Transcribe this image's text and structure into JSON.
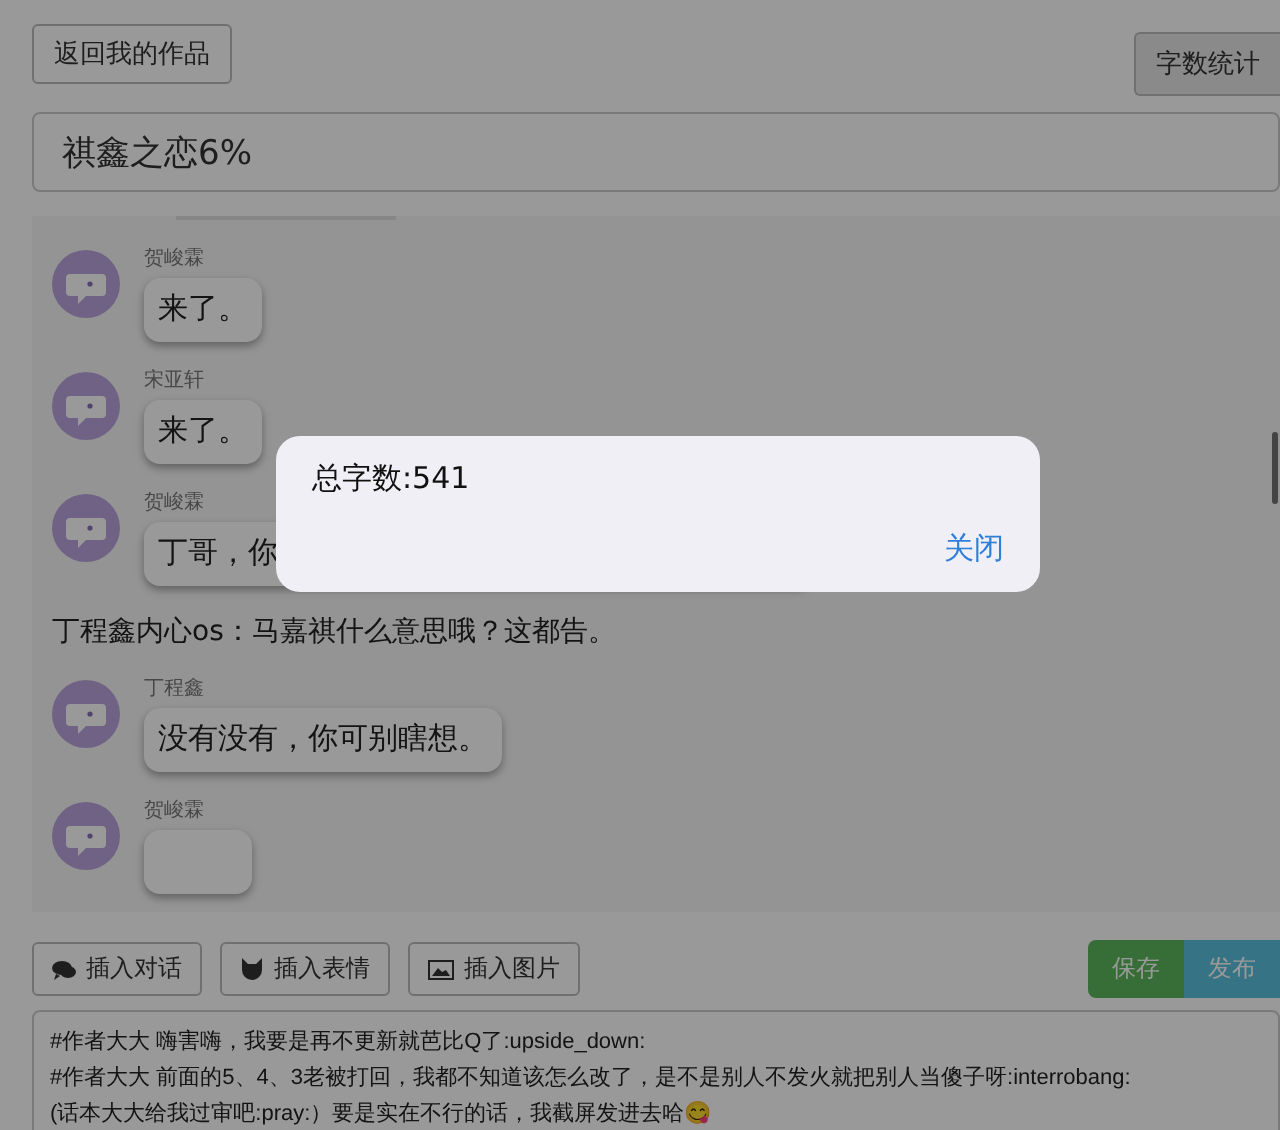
{
  "top_bar": {
    "back_button": "返回我的作品",
    "count_button": "字数统计"
  },
  "title_field": {
    "value": "祺鑫之恋6%"
  },
  "messages": [
    {
      "kind": "dialogue",
      "speaker": "贺峻霖",
      "text": "来了。"
    },
    {
      "kind": "dialogue",
      "speaker": "宋亚轩",
      "text": "来了。"
    },
    {
      "kind": "dialogue",
      "speaker": "贺峻霖",
      "text": "丁哥，你"
    },
    {
      "kind": "narration",
      "text": "丁程鑫内心os：马嘉祺什么意思哦？这都告。"
    },
    {
      "kind": "dialogue",
      "speaker": "丁程鑫",
      "text": "没有没有，你可别瞎想。"
    },
    {
      "kind": "dialogue",
      "speaker": "贺峻霖"
    }
  ],
  "toolbar": {
    "buttons": [
      {
        "kind": "chat",
        "label": "插入对话"
      },
      {
        "kind": "cat",
        "label": "插入表情"
      },
      {
        "kind": "image",
        "label": "插入图片"
      }
    ],
    "save": "保存",
    "publish": "发布"
  },
  "editor": {
    "lines": [
      "#作者大大 嗨害嗨，我要是再不更新就芭比Q了:upside_down:",
      "#作者大大 前面的5、4、3老被打回，我都不知道该怎么改了，是不是别人不发火就把别人当傻子呀:interrobang:",
      "(话本大大给我过审吧:pray:）要是实在不行的话，我截屏发进去哈😋"
    ]
  },
  "dialog": {
    "message": "总字数:541",
    "close": "关闭"
  }
}
